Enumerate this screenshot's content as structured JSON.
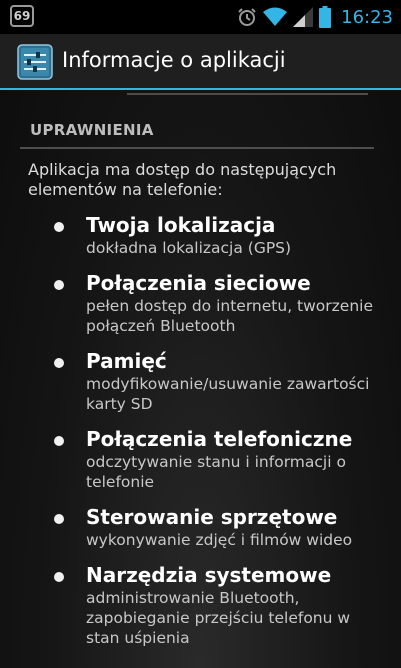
{
  "status_bar": {
    "notification_count": "69",
    "time": "16:23",
    "icons": [
      "alarm-icon",
      "wifi-icon",
      "signal-icon",
      "battery-icon"
    ]
  },
  "action_bar": {
    "title": "Informacje o aplikacji",
    "icon": "settings-sliders-icon"
  },
  "permissions": {
    "header": "UPRAWNIENIA",
    "intro": "Aplikacja ma dostęp do następujących elementów na telefonie:",
    "items": [
      {
        "title": "Twoja lokalizacja",
        "description": "dokładna lokalizacja (GPS)"
      },
      {
        "title": "Połączenia sieciowe",
        "description": "pełen dostęp do internetu, tworzenie połączeń Bluetooth"
      },
      {
        "title": "Pamięć",
        "description": "modyfikowanie/usuwanie zawartości karty SD"
      },
      {
        "title": "Połączenia telefoniczne",
        "description": "odczytywanie stanu i informacji o telefonie"
      },
      {
        "title": "Sterowanie sprzętowe",
        "description": "wykonywanie zdjęć i filmów wideo"
      },
      {
        "title": "Narzędzia systemowe",
        "description": "administrowanie Bluetooth, zapobieganie przejściu telefonu w stan uśpienia"
      }
    ]
  },
  "colors": {
    "accent": "#33b5e5",
    "background": "#151515",
    "status_bar": "#000000"
  }
}
